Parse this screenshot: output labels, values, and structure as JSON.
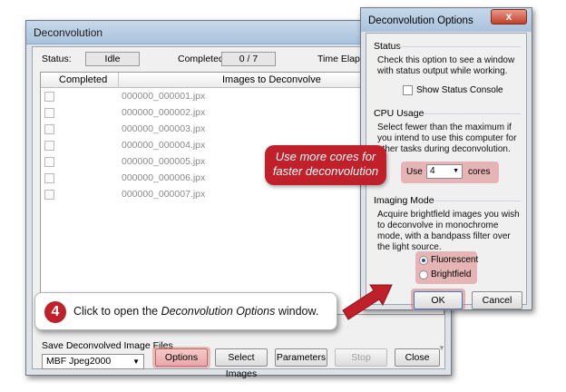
{
  "main": {
    "title": "Deconvolution",
    "status_label": "Status:",
    "status_value": "Idle",
    "completed_label": "Completed:",
    "completed_value": "0 / 7",
    "time_label": "Time Elapsed:",
    "table": {
      "headers": [
        "Completed",
        "Images to Deconvolve"
      ],
      "rows": [
        "000000_000001.jpx",
        "000000_000002.jpx",
        "000000_000003.jpx",
        "000000_000004.jpx",
        "000000_000005.jpx",
        "000000_000006.jpx",
        "000000_000007.jpx"
      ]
    },
    "save_label": "Save Deconvolved Image Files",
    "format_selected": "MBF Jpeg2000",
    "buttons": {
      "options": "Options",
      "select_images": "Select Images",
      "parameters": "Parameters",
      "stop": "Stop",
      "close": "Close"
    }
  },
  "options": {
    "title": "Deconvolution Options",
    "close_glyph": "x",
    "status": {
      "title": "Status",
      "text": "Check this option to see a window with status output while working.",
      "checkbox_label": "Show Status Console"
    },
    "cpu": {
      "title": "CPU Usage",
      "text": "Select fewer than the maximum if you intend to use this computer for other tasks during deconvolution.",
      "use_label": "Use",
      "cores_value": "4",
      "cores_label": "cores"
    },
    "imaging": {
      "title": "Imaging Mode",
      "text": "Acquire brightfield images you wish to deconvolve in monochrome mode, with a bandpass filter over the light source.",
      "fluorescent": "Fluorescent",
      "brightfield": "Brightfield",
      "selected": "Fluorescent"
    },
    "ok": "OK",
    "cancel": "Cancel"
  },
  "callouts": {
    "cores_line1": "Use more cores for",
    "cores_line2": "faster deconvolution",
    "step_number": "4",
    "step_prefix": "Click to open the ",
    "step_em": "Deconvolution  Options",
    "step_suffix": " window."
  },
  "colors": {
    "accent_red": "#c0202a",
    "highlight_pink": "#e8a7a7",
    "titlebar_blue": "#a9c2dc"
  }
}
